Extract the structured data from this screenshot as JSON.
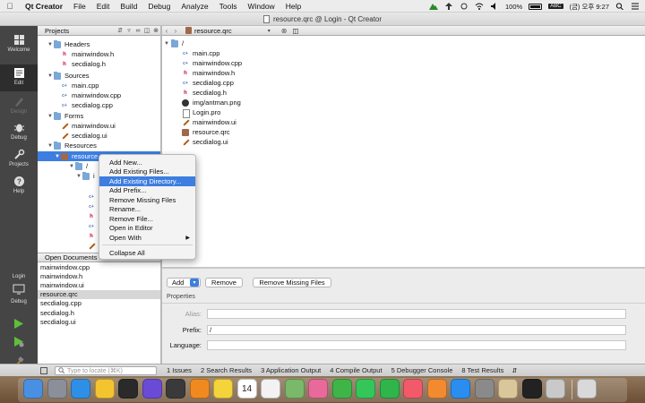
{
  "menubar": {
    "app_name": "Qt Creator",
    "items": [
      "File",
      "Edit",
      "Build",
      "Debug",
      "Analyze",
      "Tools",
      "Window",
      "Help"
    ],
    "battery": "100%",
    "input": "ABC",
    "clock": "(금) 오후 9:27"
  },
  "window": {
    "title": "resource.qrc @ Login - Qt Creator"
  },
  "modes": {
    "welcome": "Welcome",
    "edit": "Edit",
    "design": "Design",
    "debug": "Debug",
    "projects": "Projects",
    "help": "Help",
    "kit_project": "Login",
    "kit_build": "Debug"
  },
  "projects_pane": {
    "header": "Projects",
    "rows": [
      {
        "label": "Headers",
        "icon": "folder-icon"
      },
      {
        "label": "mainwindow.h",
        "icon": "header-file-icon"
      },
      {
        "label": "secdialog.h",
        "icon": "header-file-icon"
      },
      {
        "label": "Sources",
        "icon": "folder-icon"
      },
      {
        "label": "main.cpp",
        "icon": "cpp-file-icon"
      },
      {
        "label": "mainwindow.cpp",
        "icon": "cpp-file-icon"
      },
      {
        "label": "secdialog.cpp",
        "icon": "cpp-file-icon"
      },
      {
        "label": "Forms",
        "icon": "folder-icon"
      },
      {
        "label": "mainwindow.ui",
        "icon": "ui-file-icon"
      },
      {
        "label": "secdialog.ui",
        "icon": "ui-file-icon"
      },
      {
        "label": "Resources",
        "icon": "folder-icon"
      },
      {
        "label": "resource",
        "icon": "qrc-file-icon"
      },
      {
        "label": "/",
        "icon": "folder-icon"
      },
      {
        "label": "i",
        "icon": "folder-icon"
      }
    ]
  },
  "open_documents": {
    "header": "Open Documents",
    "items": [
      "mainwindow.cpp",
      "mainwindow.h",
      "mainwindow.ui",
      "resource.qrc",
      "secdialog.cpp",
      "secdialog.h",
      "secdialog.ui"
    ],
    "selected_index": 3
  },
  "editor": {
    "file_name": "resource.qrc",
    "prefix_node": "/",
    "files": [
      {
        "label": "main.cpp",
        "icon": "cpp-file-icon"
      },
      {
        "label": "mainwindow.cpp",
        "icon": "cpp-file-icon"
      },
      {
        "label": "mainwindow.h",
        "icon": "header-file-icon"
      },
      {
        "label": "secdialog.cpp",
        "icon": "cpp-file-icon"
      },
      {
        "label": "secdialog.h",
        "icon": "header-file-icon"
      },
      {
        "label": "img/antman.png",
        "icon": "image-file-icon"
      },
      {
        "label": "Login.pro",
        "icon": "project-file-icon"
      },
      {
        "label": "mainwindow.ui",
        "icon": "ui-file-icon"
      },
      {
        "label": "resource.qrc",
        "icon": "qrc-file-icon"
      },
      {
        "label": "secdialog.ui",
        "icon": "ui-file-icon"
      }
    ],
    "add_label": "Add",
    "remove_label": "Remove",
    "remove_missing_label": "Remove Missing Files",
    "properties_label": "Properties",
    "alias_label": "Alias:",
    "alias_value": "",
    "prefix_label": "Prefix:",
    "prefix_value": "/",
    "language_label": "Language:",
    "language_value": ""
  },
  "context_menu": {
    "items": [
      {
        "label": "Add New...",
        "highlighted": false
      },
      {
        "label": "Add Existing Files...",
        "highlighted": false
      },
      {
        "label": "Add Existing Directory...",
        "highlighted": true
      },
      {
        "label": "Add Prefix...",
        "highlighted": false
      },
      {
        "label": "Remove Missing Files",
        "highlighted": false
      },
      {
        "label": "Rename...",
        "highlighted": false
      },
      {
        "label": "Remove File...",
        "highlighted": false
      },
      {
        "label": "Open in Editor",
        "highlighted": false
      },
      {
        "label": "Open With",
        "highlighted": false,
        "submenu": true
      },
      {
        "label": "Collapse All",
        "highlighted": false
      }
    ]
  },
  "statusbar": {
    "locate_placeholder": "Type to locate (⌘K)",
    "tabs": [
      "1 Issues",
      "2 Search Results",
      "3 Application Output",
      "4 Compile Output",
      "5 Debugger Console",
      "8 Test Results"
    ]
  },
  "dock": {
    "icons": [
      "finder-icon",
      "launchpad-icon",
      "safari-icon",
      "chrome-icon",
      "quicktime-icon",
      "imovie-icon",
      "final-cut-icon",
      "vlc-icon",
      "notes-icon",
      "calendar-icon",
      "reminders-icon",
      "preview-icon",
      "photos-icon",
      "qt-creator-icon",
      "messages-icon",
      "facetime-icon",
      "music-icon",
      "books-icon",
      "app-store-icon",
      "system-preferences-icon",
      "preview-viewer-icon",
      "terminal-icon",
      "script-editor-icon",
      "trash-icon"
    ],
    "calendar_date": "14"
  },
  "colors": {
    "selection": "#3d7ee0",
    "sidebar": "#454545"
  }
}
